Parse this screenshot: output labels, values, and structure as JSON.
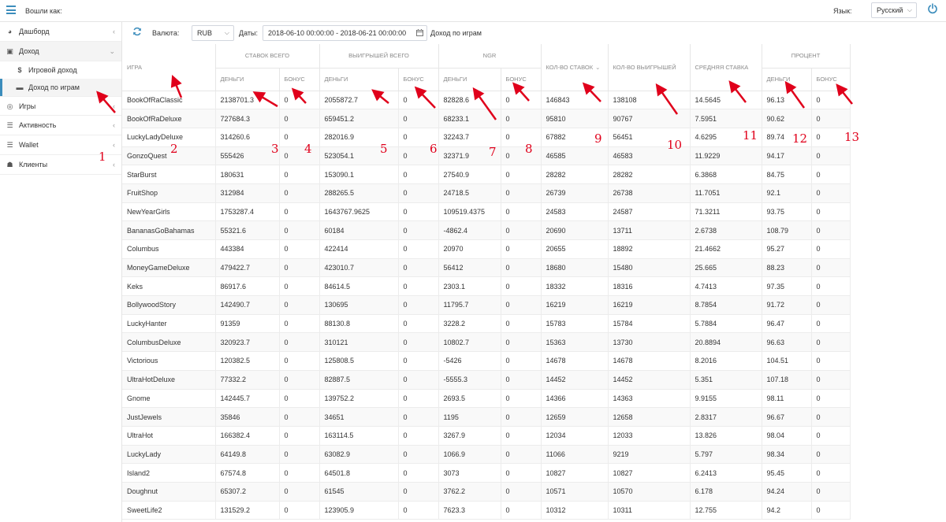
{
  "topbar": {
    "logged_in_label": "Вошли как:",
    "language_label": "Язык:",
    "language_value": "Русский"
  },
  "sidebar": {
    "items": [
      {
        "label": "Дашборд",
        "icon": "dashboard-icon"
      },
      {
        "label": "Доход",
        "icon": "money-icon"
      },
      {
        "label": "Игры",
        "icon": "gamepad-icon"
      },
      {
        "label": "Активность",
        "icon": "list-icon"
      },
      {
        "label": "Wallet",
        "icon": "list-icon"
      },
      {
        "label": "Клиенты",
        "icon": "users-icon"
      }
    ],
    "subitems": [
      {
        "label": "Игровой доход",
        "icon": "dollar-icon"
      },
      {
        "label": "Доход по играм",
        "icon": "money-icon"
      }
    ]
  },
  "filters": {
    "currency_label": "Валюта:",
    "currency_value": "RUB",
    "dates_label": "Даты:",
    "dates_value": "2018-06-10 00:00:00 - 2018-06-21 00:00:00",
    "report_label": "Доход по играм"
  },
  "table": {
    "headers": {
      "game": "ИГРА",
      "bets_total": "СТАВОК ВСЕГО",
      "wins_total": "ВЫИГРЫШЕЙ ВСЕГО",
      "ngr": "NGR",
      "bets_count": "КОЛ-ВО СТАВОК",
      "wins_count": "КОЛ-ВО ВЫИГРЫШЕЙ",
      "avg_bet": "СРЕДНЯЯ СТАВКА",
      "percent": "ПРОЦЕНТ",
      "money": "ДЕНЬГИ",
      "bonus": "БОНУС"
    },
    "rows": [
      [
        "BookOfRaClassic",
        "2138701.3",
        "0",
        "2055872.7",
        "0",
        "82828.6",
        "0",
        "146843",
        "138108",
        "14.5645",
        "96.13",
        "0"
      ],
      [
        "BookOfRaDeluxe",
        "727684.3",
        "0",
        "659451.2",
        "0",
        "68233.1",
        "0",
        "95810",
        "90767",
        "7.5951",
        "90.62",
        "0"
      ],
      [
        "LuckyLadyDeluxe",
        "314260.6",
        "0",
        "282016.9",
        "0",
        "32243.7",
        "0",
        "67882",
        "56451",
        "4.6295",
        "89.74",
        "0"
      ],
      [
        "GonzoQuest",
        "555426",
        "0",
        "523054.1",
        "0",
        "32371.9",
        "0",
        "46585",
        "46583",
        "11.9229",
        "94.17",
        "0"
      ],
      [
        "StarBurst",
        "180631",
        "0",
        "153090.1",
        "0",
        "27540.9",
        "0",
        "28282",
        "28282",
        "6.3868",
        "84.75",
        "0"
      ],
      [
        "FruitShop",
        "312984",
        "0",
        "288265.5",
        "0",
        "24718.5",
        "0",
        "26739",
        "26738",
        "11.7051",
        "92.1",
        "0"
      ],
      [
        "NewYearGirls",
        "1753287.4",
        "0",
        "1643767.9625",
        "0",
        "109519.4375",
        "0",
        "24583",
        "24587",
        "71.3211",
        "93.75",
        "0"
      ],
      [
        "BananasGoBahamas",
        "55321.6",
        "0",
        "60184",
        "0",
        "-4862.4",
        "0",
        "20690",
        "13711",
        "2.6738",
        "108.79",
        "0"
      ],
      [
        "Columbus",
        "443384",
        "0",
        "422414",
        "0",
        "20970",
        "0",
        "20655",
        "18892",
        "21.4662",
        "95.27",
        "0"
      ],
      [
        "MoneyGameDeluxe",
        "479422.7",
        "0",
        "423010.7",
        "0",
        "56412",
        "0",
        "18680",
        "15480",
        "25.665",
        "88.23",
        "0"
      ],
      [
        "Keks",
        "86917.6",
        "0",
        "84614.5",
        "0",
        "2303.1",
        "0",
        "18332",
        "18316",
        "4.7413",
        "97.35",
        "0"
      ],
      [
        "BollywoodStory",
        "142490.7",
        "0",
        "130695",
        "0",
        "11795.7",
        "0",
        "16219",
        "16219",
        "8.7854",
        "91.72",
        "0"
      ],
      [
        "LuckyHanter",
        "91359",
        "0",
        "88130.8",
        "0",
        "3228.2",
        "0",
        "15783",
        "15784",
        "5.7884",
        "96.47",
        "0"
      ],
      [
        "ColumbusDeluxe",
        "320923.7",
        "0",
        "310121",
        "0",
        "10802.7",
        "0",
        "15363",
        "13730",
        "20.8894",
        "96.63",
        "0"
      ],
      [
        "Victorious",
        "120382.5",
        "0",
        "125808.5",
        "0",
        "-5426",
        "0",
        "14678",
        "14678",
        "8.2016",
        "104.51",
        "0"
      ],
      [
        "UltraHotDeluxe",
        "77332.2",
        "0",
        "82887.5",
        "0",
        "-5555.3",
        "0",
        "14452",
        "14452",
        "5.351",
        "107.18",
        "0"
      ],
      [
        "Gnome",
        "142445.7",
        "0",
        "139752.2",
        "0",
        "2693.5",
        "0",
        "14366",
        "14363",
        "9.9155",
        "98.11",
        "0"
      ],
      [
        "JustJewels",
        "35846",
        "0",
        "34651",
        "0",
        "1195",
        "0",
        "12659",
        "12658",
        "2.8317",
        "96.67",
        "0"
      ],
      [
        "UltraHot",
        "166382.4",
        "0",
        "163114.5",
        "0",
        "3267.9",
        "0",
        "12034",
        "12033",
        "13.826",
        "98.04",
        "0"
      ],
      [
        "LuckyLady",
        "64149.8",
        "0",
        "63082.9",
        "0",
        "1066.9",
        "0",
        "11066",
        "9219",
        "5.797",
        "98.34",
        "0"
      ],
      [
        "Island2",
        "67574.8",
        "0",
        "64501.8",
        "0",
        "3073",
        "0",
        "10827",
        "10827",
        "6.2413",
        "95.45",
        "0"
      ],
      [
        "Doughnut",
        "65307.2",
        "0",
        "61545",
        "0",
        "3762.2",
        "0",
        "10571",
        "10570",
        "6.178",
        "94.24",
        "0"
      ],
      [
        "SweetLife2",
        "131529.2",
        "0",
        "123905.9",
        "0",
        "7623.3",
        "0",
        "10312",
        "10311",
        "12.755",
        "94.2",
        "0"
      ]
    ]
  },
  "annotations": [
    "1",
    "2",
    "3",
    "4",
    "5",
    "6",
    "7",
    "8",
    "9",
    "10",
    "11",
    "12",
    "13"
  ],
  "colors": {
    "accent": "#3c8dbc",
    "annotation": "#e0001b",
    "row_stripe": "#f9f9f9"
  }
}
